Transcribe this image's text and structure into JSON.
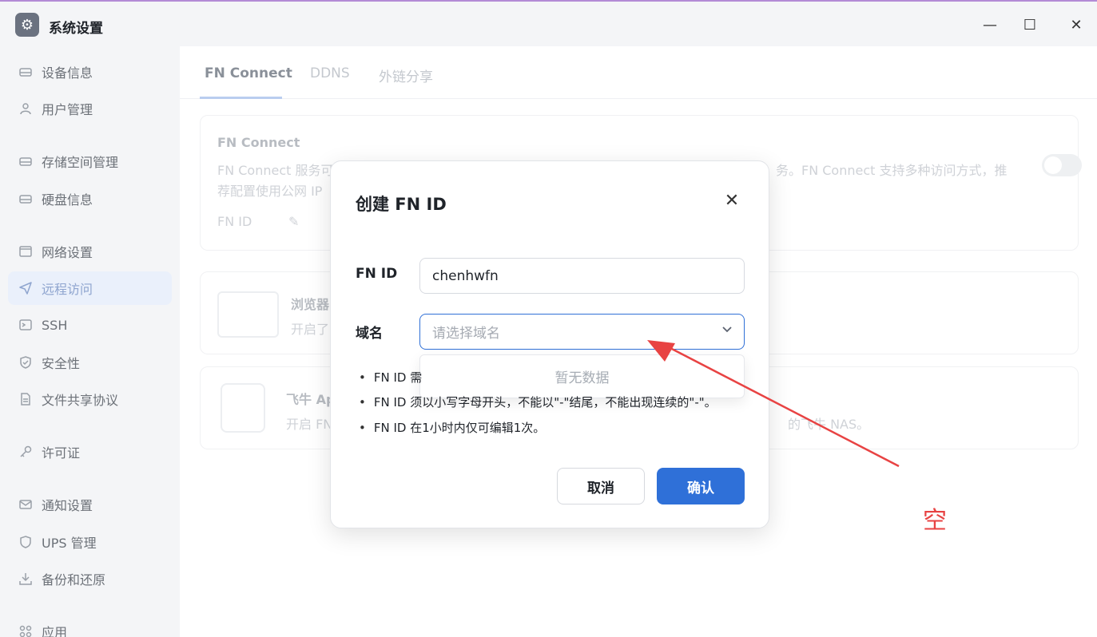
{
  "window": {
    "title": "系统设置",
    "app_icon": "gear-icon",
    "controls": {
      "minimize": "—",
      "maximize": "☐",
      "close": "✕"
    }
  },
  "sidebar": {
    "items": [
      {
        "label": "设备信息",
        "icon": "drive-icon"
      },
      {
        "label": "用户管理",
        "icon": "user-icon"
      },
      {
        "label": "存储空间管理",
        "icon": "storage-icon"
      },
      {
        "label": "硬盘信息",
        "icon": "disk-icon"
      },
      {
        "label": "网络设置",
        "icon": "network-icon"
      },
      {
        "label": "远程访问",
        "icon": "send-icon"
      },
      {
        "label": "SSH",
        "icon": "terminal-icon"
      },
      {
        "label": "安全性",
        "icon": "shield-icon"
      },
      {
        "label": "文件共享协议",
        "icon": "file-icon"
      },
      {
        "label": "许可证",
        "icon": "key-icon"
      },
      {
        "label": "通知设置",
        "icon": "mail-icon"
      },
      {
        "label": "UPS 管理",
        "icon": "ups-shield-icon"
      },
      {
        "label": "备份和还原",
        "icon": "backup-icon"
      },
      {
        "label": "应用",
        "icon": "apps-icon"
      }
    ],
    "active": "远程访问"
  },
  "tabs": [
    {
      "label": "FN Connect"
    },
    {
      "label": "DDNS"
    },
    {
      "label": "外链分享"
    }
  ],
  "fn_connect_card": {
    "title": "FN Connect",
    "desc_line1_a": "FN Connect 服务可",
    "desc_line1_b": "务。FN Connect 支持多种访问方式，推",
    "desc_line2": "荐配置使用公网 IP",
    "fn_id_label": "FN ID"
  },
  "browser_card": {
    "title": "浏览器",
    "desc": "开启了"
  },
  "app_card": {
    "title": "飞牛 Ap",
    "desc_a": "开启 FN",
    "desc_b": "的飞牛 NAS。"
  },
  "dialog": {
    "title": "创建 FN ID",
    "fn_id_label": "FN ID",
    "fn_id_value": "chenhwfn",
    "domain_label": "域名",
    "domain_placeholder": "请选择域名",
    "dropdown_empty": "暂无数据",
    "notes": [
      "FN ID 需",
      "FN ID 须以小写字母开头，不能以\"-\"结尾，不能出现连续的\"-\"。",
      "FN ID 在1小时内仅可编辑1次。"
    ],
    "cancel_label": "取消",
    "confirm_label": "确认"
  },
  "annotation": {
    "text": "空",
    "color": "#e84343"
  },
  "colors": {
    "primary": "#2f70d8",
    "annotation_red": "#e84343"
  }
}
